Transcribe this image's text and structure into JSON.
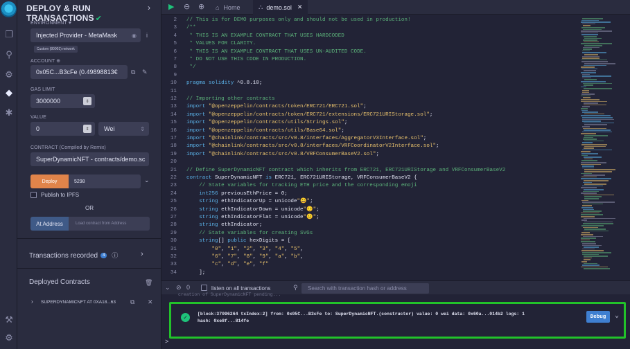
{
  "rail": {
    "icons": [
      "remix-logo",
      "file-explorer-icon",
      "search-icon",
      "solidity-compiler-icon",
      "deploy-run-icon",
      "debugger-icon",
      "plugin-manager-icon",
      "settings-icon"
    ]
  },
  "panel": {
    "title": "DEPLOY & RUN TRANSACTIONS",
    "environment_label": "ENVIRONMENT",
    "environment_value": "Injected Provider - MetaMask",
    "network_badge": "Custom (80001) network",
    "account_label": "ACCOUNT",
    "account_value": "0x05C...B3cFe (0.49898813€",
    "gas_limit_label": "GAS LIMIT",
    "gas_limit_value": "3000000",
    "value_label": "VALUE",
    "value_amount": "0",
    "value_unit": "Wei",
    "contract_label": "CONTRACT",
    "contract_label_suffix": "(Compiled by Remix)",
    "contract_value": "SuperDynamicNFT - contracts/demo.sc",
    "deploy_button": "Deploy",
    "deploy_input": "5298",
    "publish_ipfs": "Publish to IPFS",
    "or_text": "OR",
    "at_address_button": "At Address",
    "at_address_placeholder": "Load contract from Address",
    "tx_recorded_label": "Transactions recorded",
    "tx_recorded_count": "4",
    "deployed_contracts_label": "Deployed Contracts",
    "deployed_item": "SUPERDYNAMICNFT AT 0XA18...63"
  },
  "tabs": {
    "home": "Home",
    "file": "demo.sol"
  },
  "code": [
    {
      "n": "2",
      "t": [
        [
          "cmt",
          "// This is for DEMO purposes only and should not be used in production!"
        ]
      ]
    },
    {
      "n": "3",
      "t": [
        [
          "cmt",
          "/**"
        ]
      ]
    },
    {
      "n": "4",
      "t": [
        [
          "cmt",
          " * THIS IS AN EXAMPLE CONTRACT THAT USES HARDCODED"
        ]
      ]
    },
    {
      "n": "5",
      "t": [
        [
          "cmt",
          " * VALUES FOR CLARITY."
        ]
      ]
    },
    {
      "n": "6",
      "t": [
        [
          "cmt",
          " * THIS IS AN EXAMPLE CONTRACT THAT USES UN-AUDITED CODE."
        ]
      ]
    },
    {
      "n": "7",
      "t": [
        [
          "cmt",
          " * DO NOT USE THIS CODE IN PRODUCTION."
        ]
      ]
    },
    {
      "n": "8",
      "t": [
        [
          "cmt",
          " */"
        ]
      ]
    },
    {
      "n": "9",
      "t": []
    },
    {
      "n": "10",
      "t": [
        [
          "kw",
          "pragma solidity"
        ],
        [
          "plain",
          " ^0.8.10;"
        ]
      ]
    },
    {
      "n": "11",
      "t": []
    },
    {
      "n": "12",
      "t": [
        [
          "cmt",
          "// Importing other contracts"
        ]
      ]
    },
    {
      "n": "13",
      "t": [
        [
          "kw",
          "import"
        ],
        [
          "plain",
          " "
        ],
        [
          "str",
          "\"@openzeppelin/contracts/token/ERC721/ERC721.sol\""
        ],
        [
          "plain",
          ";"
        ]
      ]
    },
    {
      "n": "14",
      "t": [
        [
          "kw",
          "import"
        ],
        [
          "plain",
          " "
        ],
        [
          "str",
          "\"@openzeppelin/contracts/token/ERC721/extensions/ERC721URIStorage.sol\""
        ],
        [
          "plain",
          ";"
        ]
      ]
    },
    {
      "n": "15",
      "t": [
        [
          "kw",
          "import"
        ],
        [
          "plain",
          " "
        ],
        [
          "str",
          "\"@openzeppelin/contracts/utils/Strings.sol\""
        ],
        [
          "plain",
          ";"
        ]
      ]
    },
    {
      "n": "16",
      "t": [
        [
          "kw",
          "import"
        ],
        [
          "plain",
          " "
        ],
        [
          "str",
          "\"@openzeppelin/contracts/utils/Base64.sol\""
        ],
        [
          "plain",
          ";"
        ]
      ]
    },
    {
      "n": "17",
      "t": [
        [
          "kw",
          "import"
        ],
        [
          "plain",
          " "
        ],
        [
          "str",
          "\"@chainlink/contracts/src/v0.8/interfaces/AggregatorV3Interface.sol\""
        ],
        [
          "plain",
          ";"
        ]
      ]
    },
    {
      "n": "18",
      "t": [
        [
          "kw",
          "import"
        ],
        [
          "plain",
          " "
        ],
        [
          "str",
          "\"@chainlink/contracts/src/v0.8/interfaces/VRFCoordinatorV2Interface.sol\""
        ],
        [
          "plain",
          ";"
        ]
      ]
    },
    {
      "n": "19",
      "t": [
        [
          "kw",
          "import"
        ],
        [
          "plain",
          " "
        ],
        [
          "str",
          "\"@chainlink/contracts/src/v0.8/VRFConsumerBaseV2.sol\""
        ],
        [
          "plain",
          ";"
        ]
      ]
    },
    {
      "n": "20",
      "t": []
    },
    {
      "n": "21",
      "t": [
        [
          "cmt",
          "// Define SuperDynamicNFT contract which inherits from ERC721, ERC721URIStorage and VRFConsumerBaseV2"
        ]
      ]
    },
    {
      "n": "22",
      "t": [
        [
          "kw",
          "contract"
        ],
        [
          "plain",
          " SuperDynamicNFT "
        ],
        [
          "kw",
          "is"
        ],
        [
          "plain",
          " ERC721, ERC721URIStorage, VRFConsumerBaseV2 {"
        ]
      ]
    },
    {
      "n": "23",
      "t": [
        [
          "cmt",
          "    // State variables for tracking ETH price and the corresponding emoji"
        ]
      ]
    },
    {
      "n": "24",
      "t": [
        [
          "kw",
          "    int256"
        ],
        [
          "plain",
          " previousEthPrice = 0;"
        ]
      ]
    },
    {
      "n": "25",
      "t": [
        [
          "kw",
          "    string"
        ],
        [
          "plain",
          " ethIndicatorUp = unicode"
        ],
        [
          "str",
          "\"😀\""
        ],
        [
          "plain",
          ";"
        ]
      ]
    },
    {
      "n": "26",
      "t": [
        [
          "kw",
          "    string"
        ],
        [
          "plain",
          " ethIndicatorDown = unicode"
        ],
        [
          "str",
          "\"😔\""
        ],
        [
          "plain",
          ";"
        ]
      ]
    },
    {
      "n": "27",
      "t": [
        [
          "kw",
          "    string"
        ],
        [
          "plain",
          " ethIndicatorFlat = unicode"
        ],
        [
          "str",
          "\"😐\""
        ],
        [
          "plain",
          ";"
        ]
      ]
    },
    {
      "n": "28",
      "t": [
        [
          "kw",
          "    string"
        ],
        [
          "plain",
          " ethIndicator;"
        ]
      ]
    },
    {
      "n": "29",
      "t": [
        [
          "cmt",
          "    // State variables for creating SVGs"
        ]
      ]
    },
    {
      "n": "30",
      "t": [
        [
          "kw",
          "    string"
        ],
        [
          "plain",
          "[] "
        ],
        [
          "kw",
          "public"
        ],
        [
          "plain",
          " hexDigits = ["
        ]
      ]
    },
    {
      "n": "31",
      "t": [
        [
          "plain",
          "        "
        ],
        [
          "str",
          "\"0\""
        ],
        [
          "plain",
          ", "
        ],
        [
          "str",
          "\"1\""
        ],
        [
          "plain",
          ", "
        ],
        [
          "str",
          "\"2\""
        ],
        [
          "plain",
          ", "
        ],
        [
          "str",
          "\"3\""
        ],
        [
          "plain",
          ", "
        ],
        [
          "str",
          "\"4\""
        ],
        [
          "plain",
          ", "
        ],
        [
          "str",
          "\"5\""
        ],
        [
          "plain",
          ","
        ]
      ]
    },
    {
      "n": "32",
      "t": [
        [
          "plain",
          "        "
        ],
        [
          "str",
          "\"6\""
        ],
        [
          "plain",
          ", "
        ],
        [
          "str",
          "\"7\""
        ],
        [
          "plain",
          ", "
        ],
        [
          "str",
          "\"8\""
        ],
        [
          "plain",
          ", "
        ],
        [
          "str",
          "\"9\""
        ],
        [
          "plain",
          ", "
        ],
        [
          "str",
          "\"a\""
        ],
        [
          "plain",
          ", "
        ],
        [
          "str",
          "\"b\""
        ],
        [
          "plain",
          ","
        ]
      ]
    },
    {
      "n": "33",
      "t": [
        [
          "plain",
          "        "
        ],
        [
          "str",
          "\"c\""
        ],
        [
          "plain",
          ", "
        ],
        [
          "str",
          "\"d\""
        ],
        [
          "plain",
          ", "
        ],
        [
          "str",
          "\"e\""
        ],
        [
          "plain",
          ", "
        ],
        [
          "str",
          "\"f\""
        ]
      ]
    },
    {
      "n": "34",
      "t": [
        [
          "plain",
          "    ];"
        ]
      ]
    }
  ],
  "terminal": {
    "listen_label": "listen on all transactions",
    "search_placeholder": "Search with transaction hash or address",
    "pending_line": "creation of SuperDynamicNFT pending...",
    "tx_line1": "[block:37096264 txIndex:2] from: 0x05C...B3cFe to: SuperDynamicNFT.(constructor) value: 0 wei data: 0x60a...014b2 logs: 1",
    "tx_line2": "hash: 0xe8f...814fe",
    "debug_button": "Debug",
    "prompt": ">"
  },
  "colors": {
    "accent_orange": "#e0844a",
    "accent_blue": "#3f7fd1",
    "success_green": "#1ec27a",
    "highlight_border": "#22c22a"
  }
}
